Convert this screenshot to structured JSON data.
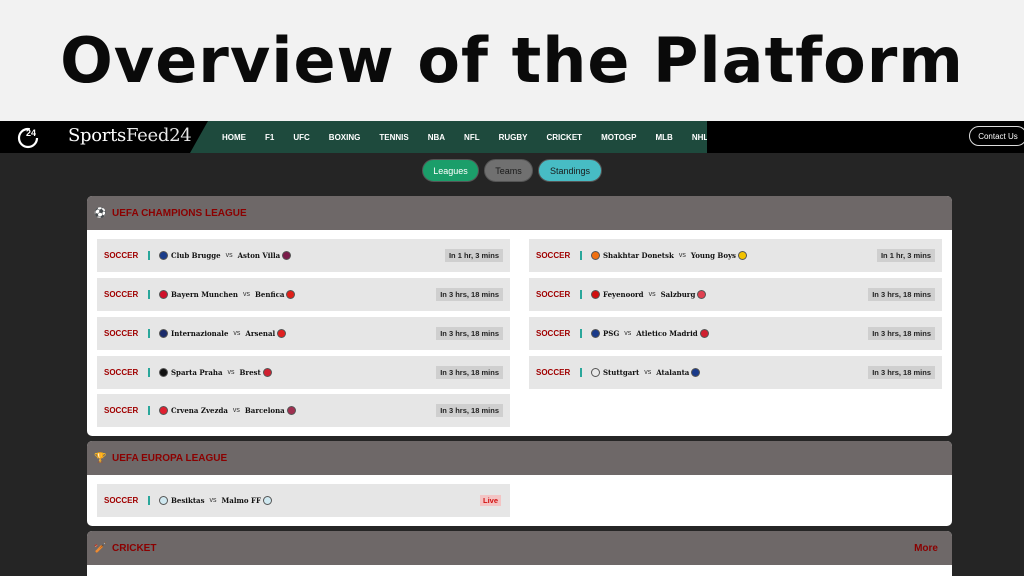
{
  "banner": {
    "title": "Overview of the Platform"
  },
  "header": {
    "logo_mark": "24",
    "logo_text_a": "Sports",
    "logo_text_b": "Feed24",
    "contact_label": "Contact Us"
  },
  "nav": [
    "HOME",
    "F1",
    "UFC",
    "BOXING",
    "TENNIS",
    "NBA",
    "NFL",
    "RUGBY",
    "CRICKET",
    "MOTOGP",
    "MLB",
    "NHL"
  ],
  "pills": {
    "leagues": "Leagues",
    "teams": "Teams",
    "standings": "Standings"
  },
  "champions": {
    "title": "UEFA CHAMPIONS LEAGUE",
    "icon": "soccer-ball-icon",
    "left": [
      {
        "sport": "SOCCER",
        "home": "Club Brugge",
        "away": "Aston Villa",
        "time": "In 1 hr, 3 mins"
      },
      {
        "sport": "SOCCER",
        "home": "Bayern Munchen",
        "away": "Benfica",
        "time": "In 3 hrs, 18 mins"
      },
      {
        "sport": "SOCCER",
        "home": "Internazionale",
        "away": "Arsenal",
        "time": "In 3 hrs, 18 mins"
      },
      {
        "sport": "SOCCER",
        "home": "Sparta Praha",
        "away": "Brest",
        "time": "In 3 hrs, 18 mins"
      },
      {
        "sport": "SOCCER",
        "home": "Crvena Zvezda",
        "away": "Barcelona",
        "time": "In 3 hrs, 18 mins"
      }
    ],
    "right": [
      {
        "sport": "SOCCER",
        "home": "Shakhtar Donetsk",
        "away": "Young Boys",
        "time": "In 1 hr, 3 mins"
      },
      {
        "sport": "SOCCER",
        "home": "Feyenoord",
        "away": "Salzburg",
        "time": "In 3 hrs, 18 mins"
      },
      {
        "sport": "SOCCER",
        "home": "PSG",
        "away": "Atletico Madrid",
        "time": "In 3 hrs, 18 mins"
      },
      {
        "sport": "SOCCER",
        "home": "Stuttgart",
        "away": "Atalanta",
        "time": "In 3 hrs, 18 mins"
      }
    ]
  },
  "europa": {
    "title": "UEFA EUROPA LEAGUE",
    "icon": "trophy-icon",
    "rows": [
      {
        "sport": "SOCCER",
        "home": "Besiktas",
        "away": "Malmo FF",
        "status": "Live"
      }
    ]
  },
  "cricket": {
    "title": "CRICKET",
    "icon": "cricket-bat-icon",
    "more_label": "More"
  },
  "vs_label": "vs",
  "colors": {
    "nav_bg": "#1e4a3d",
    "accent_red": "#8b0000",
    "leagues_pill": "#1b9e6a",
    "standings_pill": "#47bcc4",
    "live_red": "#d21010"
  }
}
